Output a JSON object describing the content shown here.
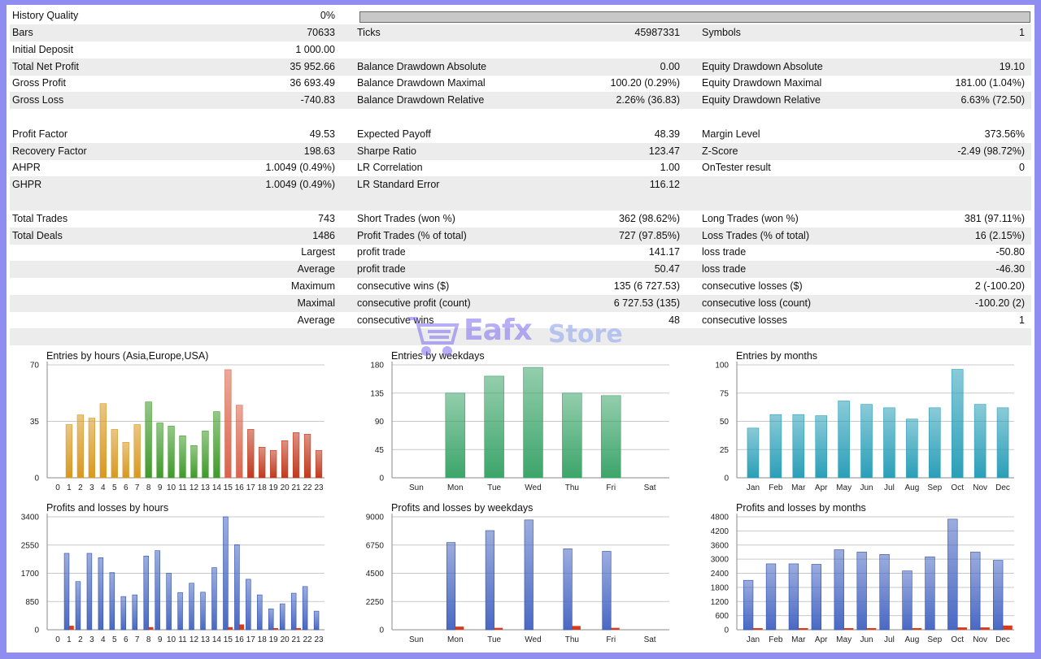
{
  "history_quality": {
    "label": "History Quality",
    "value": "0%",
    "progress": 0
  },
  "stats_rows": [
    {
      "shade": true,
      "cells": [
        [
          "Bars",
          "70633"
        ],
        [
          "Ticks",
          "45987331"
        ],
        [
          "Symbols",
          "1"
        ]
      ]
    },
    {
      "shade": false,
      "cells": [
        [
          "Initial Deposit",
          "1 000.00"
        ],
        [
          "",
          ""
        ],
        [
          "",
          ""
        ]
      ]
    },
    {
      "shade": true,
      "cells": [
        [
          "Total Net Profit",
          "35 952.66"
        ],
        [
          "Balance Drawdown Absolute",
          "0.00"
        ],
        [
          "Equity Drawdown Absolute",
          "19.10"
        ]
      ]
    },
    {
      "shade": false,
      "cells": [
        [
          "Gross Profit",
          "36 693.49"
        ],
        [
          "Balance Drawdown Maximal",
          "100.20 (0.29%)"
        ],
        [
          "Equity Drawdown Maximal",
          "181.00 (1.04%)"
        ]
      ]
    },
    {
      "shade": true,
      "cells": [
        [
          "Gross Loss",
          "-740.83"
        ],
        [
          "Balance Drawdown Relative",
          "2.26% (36.83)"
        ],
        [
          "Equity Drawdown Relative",
          "6.63% (72.50)"
        ]
      ]
    },
    {
      "shade": false,
      "cells": [
        [
          "",
          ""
        ],
        [
          "",
          ""
        ],
        [
          "",
          ""
        ]
      ]
    },
    {
      "shade": false,
      "cells": [
        [
          "Profit Factor",
          "49.53"
        ],
        [
          "Expected Payoff",
          "48.39"
        ],
        [
          "Margin Level",
          "373.56%"
        ]
      ]
    },
    {
      "shade": true,
      "cells": [
        [
          "Recovery Factor",
          "198.63"
        ],
        [
          "Sharpe Ratio",
          "123.47"
        ],
        [
          "Z-Score",
          "-2.49 (98.72%)"
        ]
      ]
    },
    {
      "shade": false,
      "cells": [
        [
          "AHPR",
          "1.0049 (0.49%)"
        ],
        [
          "LR Correlation",
          "1.00"
        ],
        [
          "OnTester result",
          "0"
        ]
      ]
    },
    {
      "shade": true,
      "cells": [
        [
          "GHPR",
          "1.0049 (0.49%)"
        ],
        [
          "LR Standard Error",
          "116.12"
        ],
        [
          "",
          ""
        ]
      ]
    },
    {
      "shade": true,
      "cells": [
        [
          "",
          ""
        ],
        [
          "",
          ""
        ],
        [
          "",
          ""
        ]
      ]
    },
    {
      "shade": false,
      "cells": [
        [
          "Total Trades",
          "743"
        ],
        [
          "Short Trades (won %)",
          "362 (98.62%)"
        ],
        [
          "Long Trades (won %)",
          "381 (97.11%)"
        ]
      ]
    },
    {
      "shade": true,
      "cells": [
        [
          "Total Deals",
          "1486"
        ],
        [
          "Profit Trades (% of total)",
          "727 (97.85%)"
        ],
        [
          "Loss Trades (% of total)",
          "16 (2.15%)"
        ]
      ]
    },
    {
      "shade": false,
      "rlabel": "Largest",
      "cells": [
        [
          "",
          ""
        ],
        [
          "profit trade",
          "141.17"
        ],
        [
          "loss trade",
          "-50.80"
        ]
      ]
    },
    {
      "shade": true,
      "rlabel": "Average",
      "cells": [
        [
          "",
          ""
        ],
        [
          "profit trade",
          "50.47"
        ],
        [
          "loss trade",
          "-46.30"
        ]
      ]
    },
    {
      "shade": false,
      "rlabel": "Maximum",
      "cells": [
        [
          "",
          ""
        ],
        [
          "consecutive wins ($)",
          "135 (6 727.53)"
        ],
        [
          "consecutive losses ($)",
          "2 (-100.20)"
        ]
      ]
    },
    {
      "shade": true,
      "rlabel": "Maximal",
      "cells": [
        [
          "",
          ""
        ],
        [
          "consecutive profit (count)",
          "6 727.53 (135)"
        ],
        [
          "consecutive loss (count)",
          "-100.20 (2)"
        ]
      ]
    },
    {
      "shade": false,
      "rlabel": "Average",
      "cells": [
        [
          "",
          ""
        ],
        [
          "consecutive wins",
          "48"
        ],
        [
          "consecutive losses",
          "1"
        ]
      ]
    },
    {
      "shade": true,
      "cells": [
        [
          "",
          ""
        ],
        [
          "",
          ""
        ],
        [
          "",
          ""
        ]
      ]
    }
  ],
  "watermark": {
    "brand": "Eafx",
    "suffix": "Store"
  },
  "chart_data": [
    {
      "type": "bar",
      "title": "Entries by hours (Asia,Europe,USA)",
      "categories": [
        "0",
        "1",
        "2",
        "3",
        "4",
        "5",
        "6",
        "7",
        "8",
        "9",
        "10",
        "11",
        "12",
        "13",
        "14",
        "15",
        "16",
        "17",
        "18",
        "19",
        "20",
        "21",
        "22",
        "23"
      ],
      "values": [
        0,
        33,
        39,
        37,
        46,
        30,
        22,
        33,
        47,
        34,
        32,
        26,
        20,
        29,
        41,
        67,
        45,
        30,
        19,
        17,
        23,
        28,
        27,
        17
      ],
      "yticks": [
        0,
        35,
        70
      ],
      "ylim": [
        0,
        70
      ],
      "colors": [
        "#d99820",
        "#d99820",
        "#d99820",
        "#d99820",
        "#d99820",
        "#d99820",
        "#d99820",
        "#d99820",
        "#3f9a2a",
        "#3f9a2a",
        "#3f9a2a",
        "#3f9a2a",
        "#3f9a2a",
        "#3f9a2a",
        "#3f9a2a",
        "#d9644a",
        "#d9644a",
        "#c0391e",
        "#c0391e",
        "#c0391e",
        "#c0391e",
        "#c0391e",
        "#c0391e",
        "#c0391e"
      ]
    },
    {
      "type": "bar",
      "title": "Entries by weekdays",
      "categories": [
        "Sun",
        "Mon",
        "Tue",
        "Wed",
        "Thu",
        "Fri",
        "Sat"
      ],
      "values": [
        0,
        135,
        162,
        176,
        135,
        131,
        0
      ],
      "yticks": [
        0,
        45,
        90,
        135,
        180
      ],
      "ylim": [
        0,
        180
      ],
      "colors": [
        "#3ca56a"
      ]
    },
    {
      "type": "bar",
      "title": "Entries by months",
      "categories": [
        "Jan",
        "Feb",
        "Mar",
        "Apr",
        "May",
        "Jun",
        "Jul",
        "Aug",
        "Sep",
        "Oct",
        "Nov",
        "Dec"
      ],
      "values": [
        44,
        56,
        56,
        55,
        68,
        65,
        62,
        52,
        62,
        96,
        65,
        62
      ],
      "yticks": [
        0,
        25,
        50,
        75,
        100
      ],
      "ylim": [
        0,
        100
      ],
      "colors": [
        "#2a9fb8"
      ]
    },
    {
      "type": "bar",
      "title": "Profits and losses by hours",
      "categories": [
        "0",
        "1",
        "2",
        "3",
        "4",
        "5",
        "6",
        "7",
        "8",
        "9",
        "10",
        "11",
        "12",
        "13",
        "14",
        "15",
        "16",
        "17",
        "18",
        "19",
        "20",
        "21",
        "22",
        "23"
      ],
      "series": [
        {
          "name": "profit",
          "values": [
            0,
            2300,
            1450,
            2300,
            2170,
            1720,
            1000,
            1050,
            2220,
            2380,
            1700,
            1120,
            1400,
            1130,
            1870,
            3400,
            2560,
            1520,
            1050,
            630,
            780,
            1100,
            1300,
            560
          ]
        },
        {
          "name": "loss",
          "values": [
            0,
            120,
            0,
            0,
            0,
            0,
            0,
            0,
            80,
            0,
            0,
            0,
            0,
            0,
            0,
            80,
            160,
            0,
            0,
            40,
            0,
            50,
            0,
            0
          ]
        }
      ],
      "yticks": [
        0,
        850,
        1700,
        2550,
        3400
      ],
      "ylim": [
        0,
        3400
      ],
      "colors": [
        "#4a69c4",
        "#d83a1a"
      ]
    },
    {
      "type": "bar",
      "title": "Profits and losses by weekdays",
      "categories": [
        "Sun",
        "Mon",
        "Tue",
        "Wed",
        "Thu",
        "Fri",
        "Sat"
      ],
      "series": [
        {
          "name": "profit",
          "values": [
            0,
            6950,
            7900,
            8750,
            6450,
            6250,
            0
          ]
        },
        {
          "name": "loss",
          "values": [
            0,
            250,
            150,
            0,
            300,
            150,
            0
          ]
        }
      ],
      "yticks": [
        0,
        2250,
        4500,
        6750,
        9000
      ],
      "ylim": [
        0,
        9000
      ],
      "colors": [
        "#4a69c4",
        "#d83a1a"
      ]
    },
    {
      "type": "bar",
      "title": "Profits and losses by months",
      "categories": [
        "Jan",
        "Feb",
        "Mar",
        "Apr",
        "May",
        "Jun",
        "Jul",
        "Aug",
        "Sep",
        "Oct",
        "Nov",
        "Dec"
      ],
      "series": [
        {
          "name": "profit",
          "values": [
            2100,
            2800,
            2800,
            2780,
            3400,
            3300,
            3200,
            2500,
            3100,
            4700,
            3300,
            2950
          ]
        },
        {
          "name": "loss",
          "values": [
            40,
            0,
            60,
            0,
            60,
            40,
            0,
            60,
            0,
            100,
            100,
            180
          ]
        }
      ],
      "yticks": [
        0,
        600,
        1200,
        1800,
        2400,
        3000,
        3600,
        4200,
        4800
      ],
      "ylim": [
        0,
        4800
      ],
      "colors": [
        "#4a69c4",
        "#d83a1a"
      ]
    }
  ]
}
